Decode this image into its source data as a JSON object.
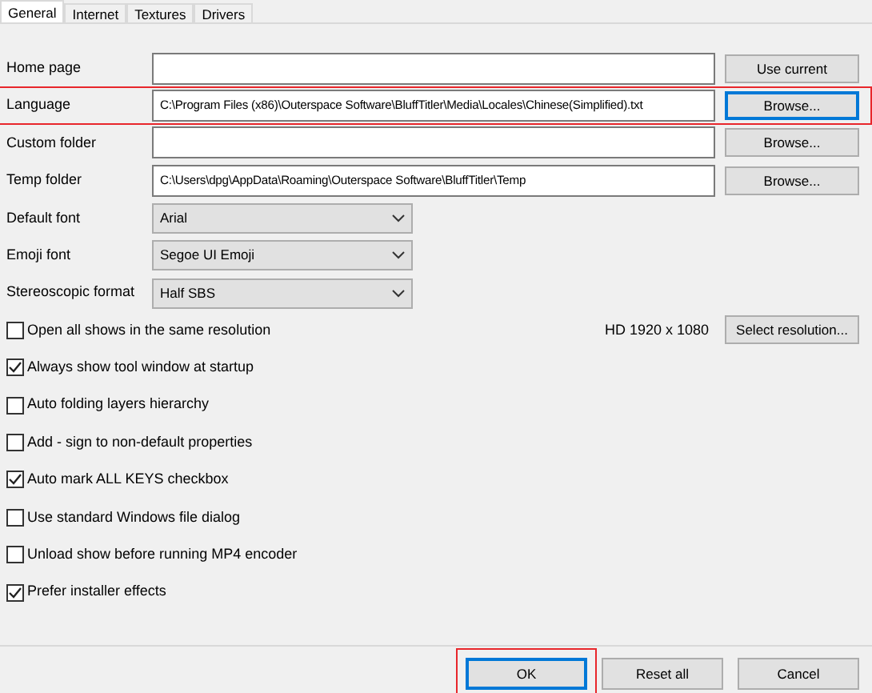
{
  "tabs": [
    {
      "label": "General",
      "selected": true
    },
    {
      "label": "Internet",
      "selected": false
    },
    {
      "label": "Textures",
      "selected": false
    },
    {
      "label": "Drivers",
      "selected": false
    }
  ],
  "rows": [
    {
      "kind": "path",
      "label": "Home page",
      "button": "Use current",
      "highlighted": false
    },
    {
      "kind": "path",
      "label": "Language",
      "value": "C:\\Program Files (x86)\\Outerspace Software\\BluffTitler\\Media\\Locales\\Chinese(Simplified).txt",
      "button": "Browse...",
      "highlighted": true
    },
    {
      "kind": "path",
      "label": "Custom folder",
      "button": "Browse...",
      "highlighted": false
    },
    {
      "kind": "path",
      "label": "Temp folder",
      "value": "C:\\Users\\dpg\\AppData\\Roaming\\Outerspace Software\\BluffTitler\\Temp",
      "button": "Browse...",
      "highlighted": false
    },
    {
      "kind": "select",
      "label": "Default font",
      "value": "Arial"
    },
    {
      "kind": "select",
      "label": "Emoji font",
      "value": "Segoe UI Emoji"
    },
    {
      "kind": "select",
      "label": "Stereoscopic format",
      "value": "Half SBS"
    },
    {
      "kind": "checkbox",
      "label": "Open all shows in the same resolution",
      "checked": false,
      "reading": "HD 1920 x 1080",
      "button": "Select resolution..."
    },
    {
      "kind": "checkbox",
      "label": "Always show tool window at startup",
      "checked": true
    },
    {
      "kind": "checkbox",
      "label": "Auto folding layers hierarchy",
      "checked": false
    },
    {
      "kind": "checkbox",
      "label": "Add - sign to non-default properties",
      "checked": false
    },
    {
      "kind": "checkbox",
      "label": "Auto mark ALL KEYS checkbox",
      "checked": true
    },
    {
      "kind": "checkbox",
      "label": "Use standard Windows file dialog",
      "checked": false
    },
    {
      "kind": "checkbox",
      "label": "Unload show before running MP4 encoder",
      "checked": false
    },
    {
      "kind": "checkbox",
      "label": "Prefer installer effects",
      "checked": true
    }
  ],
  "buttons": [
    {
      "label": "OK",
      "highlighted": true
    },
    {
      "label": "Reset all",
      "highlighted": false
    },
    {
      "label": "Cancel",
      "highlighted": false
    }
  ]
}
